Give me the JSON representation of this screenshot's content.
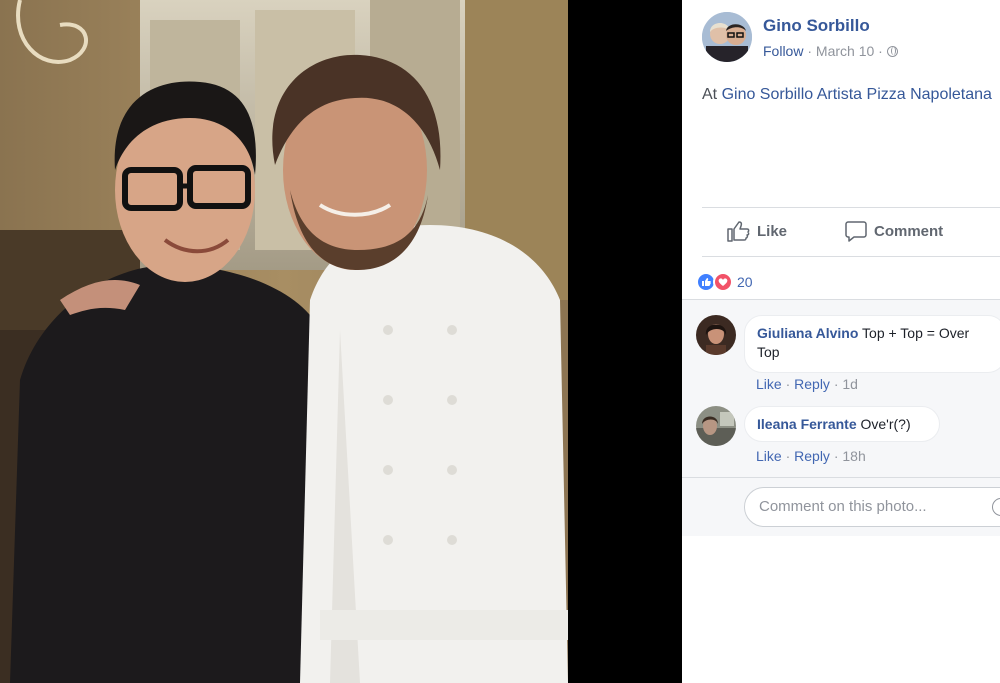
{
  "post": {
    "author": "Gino Sorbillo",
    "follow_label": "Follow",
    "date": "March 10",
    "sep1": " · ",
    "sep2": " · ",
    "location_prefix": "At ",
    "location_name": "Gino Sorbillo Artista Pizza Napoletana"
  },
  "actions": {
    "like_label": "Like",
    "comment_label": "Comment"
  },
  "reactions": {
    "count": "20",
    "types": [
      "like",
      "love"
    ]
  },
  "comments": [
    {
      "author": "Giuliana Alvino",
      "text": "Top + Top = Over",
      "text_line2": "Top",
      "like_label": "Like",
      "reply_label": "Reply",
      "time": "1d"
    },
    {
      "author": "Ileana Ferrante",
      "text": "Ove'r(?)",
      "like_label": "Like",
      "reply_label": "Reply",
      "time": "18h"
    }
  ],
  "composer": {
    "placeholder": "Comment on this photo..."
  },
  "icons": {
    "globe": "globe-icon",
    "like": "thumbs-up-icon",
    "comment": "speech-bubble-icon",
    "emoji": "smiley-icon"
  },
  "colors": {
    "link": "#365899",
    "meta": "#90949c",
    "action": "#616770",
    "like_reaction": "#4080ff",
    "love_reaction": "#f25268",
    "comments_bg": "#f6f7f9"
  }
}
